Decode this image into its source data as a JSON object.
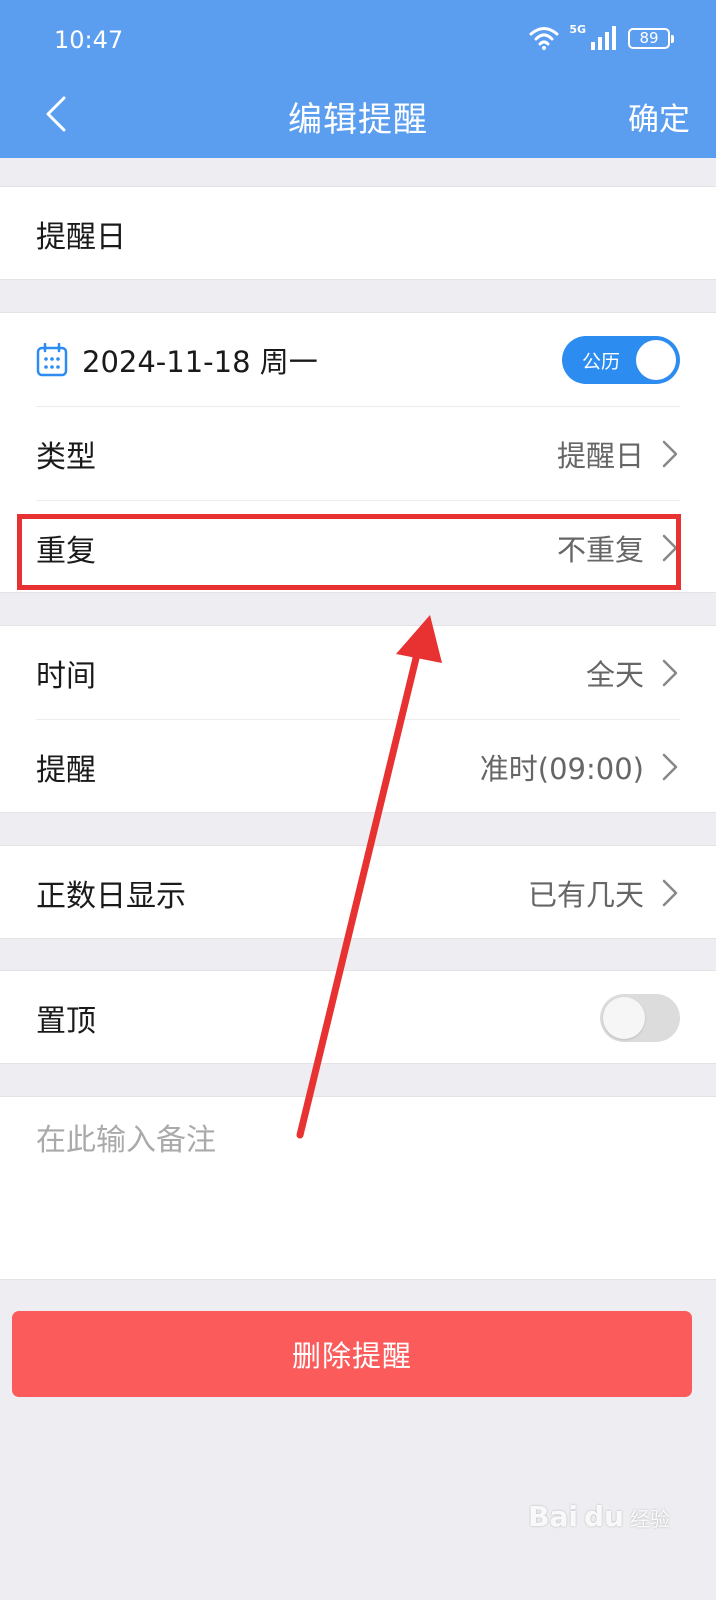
{
  "status_bar": {
    "time": "10:47",
    "network": "5G",
    "battery": "89"
  },
  "nav": {
    "title": "编辑提醒",
    "confirm": "确定"
  },
  "reminder_name": "提醒日",
  "date": {
    "value": "2024-11-18 周一",
    "calendar_toggle": "公历",
    "calendar_toggle_on": true
  },
  "rows": {
    "type": {
      "label": "类型",
      "value": "提醒日"
    },
    "repeat": {
      "label": "重复",
      "value": "不重复"
    },
    "time": {
      "label": "时间",
      "value": "全天"
    },
    "remind": {
      "label": "提醒",
      "value": "准时(09:00)"
    },
    "count_display": {
      "label": "正数日显示",
      "value": "已有几天"
    },
    "pin": {
      "label": "置顶",
      "enabled": false
    }
  },
  "note": {
    "placeholder": "在此输入备注",
    "value": ""
  },
  "delete_button": "删除提醒",
  "watermark": {
    "brand": "Bai",
    "brand2": "du",
    "sub": "经验"
  },
  "colors": {
    "header": "#5b9ef0",
    "toggle_on": "#2d8cf0",
    "delete": "#fc5b5c",
    "annotation": "#e83232"
  }
}
